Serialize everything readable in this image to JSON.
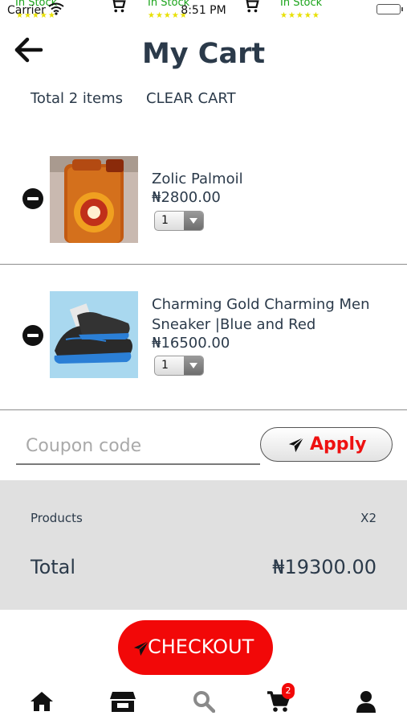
{
  "status_bar": {
    "carrier": "Carrier",
    "time": "8:51 PM",
    "overlay_text": [
      "In Stock",
      "In Stock",
      "In Stock"
    ]
  },
  "header": {
    "title": "My Cart",
    "back_icon": "arrow-left-icon"
  },
  "cart_summary_bar": {
    "total_items": "Total 2 items",
    "clear_cart": "CLEAR CART"
  },
  "items": [
    {
      "name": "Zolic Palmoil",
      "price": "₦2800.00",
      "quantity": "1"
    },
    {
      "name": "Charming Gold Charming Men Sneaker |Blue and Red",
      "price": "₦16500.00",
      "quantity": "1"
    }
  ],
  "coupon": {
    "placeholder": "Coupon code",
    "value": "",
    "apply_label": "Apply"
  },
  "summary": {
    "products_label": "Products",
    "products_count": "X2",
    "total_label": "Total",
    "total_value": "₦19300.00"
  },
  "checkout": {
    "label": "CHECKOUT"
  },
  "bottom_nav": {
    "items": [
      "home-icon",
      "store-icon",
      "search-icon",
      "cart-icon",
      "user-icon"
    ],
    "cart_badge": "2"
  },
  "colors": {
    "accent": "#f20808",
    "text": "#2b3a4a",
    "summary_bg": "#e0e0e0",
    "stock_green": "#19a319"
  }
}
